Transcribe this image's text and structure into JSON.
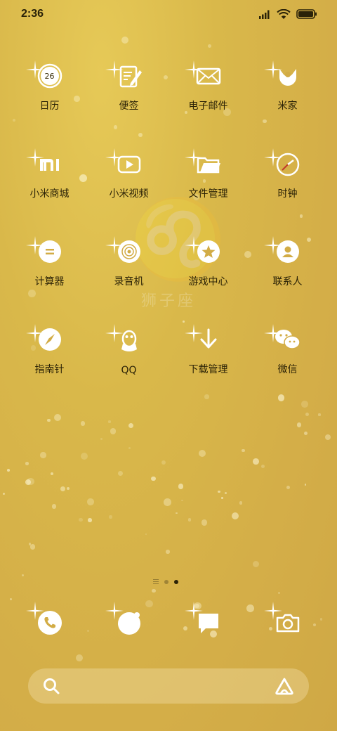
{
  "status_bar": {
    "time": "2:36",
    "icons": [
      "signal-icon",
      "wifi-icon",
      "battery-icon"
    ]
  },
  "watermark": {
    "symbol": "♌",
    "text": "狮子座"
  },
  "apps": [
    {
      "label": "日历",
      "icon": "calendar-icon",
      "badge": "26"
    },
    {
      "label": "便签",
      "icon": "notes-icon"
    },
    {
      "label": "电子邮件",
      "icon": "mail-icon"
    },
    {
      "label": "米家",
      "icon": "mijia-icon"
    },
    {
      "label": "小米商城",
      "icon": "mi-store-icon"
    },
    {
      "label": "小米视频",
      "icon": "video-icon"
    },
    {
      "label": "文件管理",
      "icon": "folder-icon"
    },
    {
      "label": "时钟",
      "icon": "clock-icon"
    },
    {
      "label": "计算器",
      "icon": "calculator-icon"
    },
    {
      "label": "录音机",
      "icon": "recorder-icon"
    },
    {
      "label": "游戏中心",
      "icon": "game-star-icon"
    },
    {
      "label": "联系人",
      "icon": "contacts-icon"
    },
    {
      "label": "指南针",
      "icon": "compass-icon"
    },
    {
      "label": "QQ",
      "icon": "qq-penguin-icon"
    },
    {
      "label": "下载管理",
      "icon": "download-icon"
    },
    {
      "label": "微信",
      "icon": "wechat-icon"
    }
  ],
  "page_indicator": {
    "pages": 2,
    "active": 2
  },
  "dock": [
    {
      "icon": "phone-icon"
    },
    {
      "icon": "browser-icon"
    },
    {
      "icon": "message-icon"
    },
    {
      "icon": "camera-icon"
    }
  ],
  "search_bar": {
    "left_icon": "search-icon",
    "right_icon": "assistant-icon"
  },
  "colors": {
    "icon_white": "#ffffff",
    "icon_gold": "#d2ac46",
    "text": "#2b2206"
  }
}
